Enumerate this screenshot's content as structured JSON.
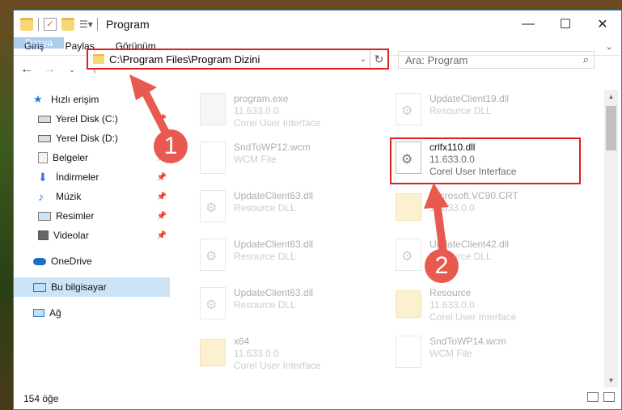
{
  "window": {
    "title": "Program"
  },
  "ribbon": {
    "tabs": [
      "Dosya",
      "Giriş",
      "Paylaş",
      "Görünüm"
    ]
  },
  "address": {
    "path": "C:\\Program Files\\Program Dizini"
  },
  "search": {
    "placeholder": "Ara: Program"
  },
  "sidebar": {
    "items": [
      {
        "label": "Hızlı erişim",
        "icon": "star-icon"
      },
      {
        "label": "Yerel Disk (C:)",
        "icon": "drive-icon"
      },
      {
        "label": "Yerel Disk (D:)",
        "icon": "drive-icon"
      },
      {
        "label": "Belgeler",
        "icon": "documents-icon"
      },
      {
        "label": "İndirmeler",
        "icon": "download-icon"
      },
      {
        "label": "Müzik",
        "icon": "music-icon"
      },
      {
        "label": "Resimler",
        "icon": "pictures-icon"
      },
      {
        "label": "Videolar",
        "icon": "video-icon"
      },
      {
        "label": "OneDrive",
        "icon": "cloud-icon"
      },
      {
        "label": "Bu bilgisayar",
        "icon": "computer-icon"
      },
      {
        "label": "Ağ",
        "icon": "network-icon"
      }
    ]
  },
  "files": [
    {
      "name": "program.exe",
      "l1": "11.633.0.0",
      "l2": "Corel User Interface"
    },
    {
      "name": "UpdateClient19.dll",
      "l1": "Resource DLL",
      "l2": ""
    },
    {
      "name": "SndToWP12.wcm",
      "l1": "WCM File",
      "l2": ""
    },
    {
      "name": "crlfx110.dll",
      "l1": "11.633.0.0",
      "l2": "Corel User Interface"
    },
    {
      "name": "UpdateClient63.dll",
      "l1": "Resource DLL",
      "l2": ""
    },
    {
      "name": "Microsoft.VC90.CRT",
      "l1": "11.633.0.0",
      "l2": ""
    },
    {
      "name": "UpdateClient63.dll",
      "l1": "Resource DLL",
      "l2": ""
    },
    {
      "name": "UpdateClient42.dll",
      "l1": "Resource DLL",
      "l2": ""
    },
    {
      "name": "UpdateClient63.dll",
      "l1": "Resource DLL",
      "l2": ""
    },
    {
      "name": "Resource",
      "l1": "11.633.0.0",
      "l2": "Corel User Interface"
    },
    {
      "name": "x64",
      "l1": "11.633.0.0",
      "l2": "Corel User Interface"
    },
    {
      "name": "SndToWP14.wcm",
      "l1": "WCM File",
      "l2": ""
    }
  ],
  "status": {
    "count": "154 öğe"
  },
  "markers": [
    "1",
    "2"
  ]
}
